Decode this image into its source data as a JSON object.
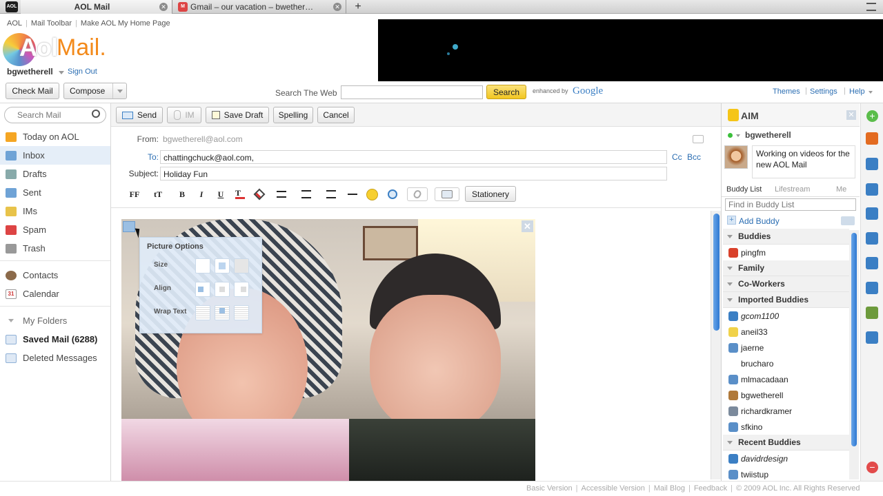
{
  "browser_tabs": [
    {
      "title": "AOL Mail",
      "favicon": "AOL"
    },
    {
      "title": "Gmail – our vacation – bwether…",
      "favicon": "M"
    }
  ],
  "top_links": [
    "AOL",
    "Mail Toolbar",
    "Make AOL My Home Page"
  ],
  "logo": {
    "left": "Aol",
    "right": "Mail."
  },
  "user": {
    "name": "bgwetherell",
    "signout": "Sign Out"
  },
  "toolbar": {
    "check_mail": "Check Mail",
    "compose": "Compose",
    "search_web_label": "Search The Web",
    "search_btn": "Search",
    "enhanced_by": "enhanced by",
    "google": "Google"
  },
  "settings_links": [
    "Themes",
    "Settings",
    "Help"
  ],
  "search_mail": {
    "placeholder": "Search Mail"
  },
  "folders": [
    {
      "label": "Today on AOL",
      "icon": "sun-icon",
      "color": "#f5a623"
    },
    {
      "label": "Inbox",
      "icon": "inbox-icon",
      "color": "#6fa3d6"
    },
    {
      "label": "Drafts",
      "icon": "drafts-icon",
      "color": "#8aa"
    },
    {
      "label": "Sent",
      "icon": "sent-icon",
      "color": "#6fa3d6"
    },
    {
      "label": "IMs",
      "icon": "ims-icon",
      "color": "#e8c34a"
    },
    {
      "label": "Spam",
      "icon": "spam-icon",
      "color": "#d44"
    },
    {
      "label": "Trash",
      "icon": "trash-icon",
      "color": "#999"
    }
  ],
  "tools": [
    {
      "label": "Contacts"
    },
    {
      "label": "Calendar",
      "badge": "31"
    }
  ],
  "my_folders": {
    "title": "My Folders",
    "items": [
      {
        "label": "Saved Mail (6288)",
        "bold": true
      },
      {
        "label": "Deleted Messages"
      }
    ]
  },
  "compose_actions": {
    "send": "Send",
    "im": "IM",
    "save_draft": "Save Draft",
    "spelling": "Spelling",
    "cancel": "Cancel"
  },
  "compose": {
    "from_label": "From:",
    "from_value": "bgwetherell@aol.com",
    "to_label": "To:",
    "to_value": "chattingchuck@aol.com,",
    "cc": "Cc",
    "bcc": "Bcc",
    "subject_label": "Subject:",
    "subject_value": "Holiday Fun"
  },
  "format_bar": {
    "ff": "FF",
    "tt": "tT",
    "bold": "B",
    "italic": "I",
    "underline": "U",
    "stationery": "Stationery"
  },
  "picture_options": {
    "title": "Picture Options",
    "size": "Size",
    "align": "Align",
    "wrap": "Wrap Text"
  },
  "aim": {
    "title": "AIM",
    "user": "bgwetherell",
    "status": "Working on videos for the new AOL Mail",
    "tabs": [
      "Buddy List",
      "Lifestream",
      "Me"
    ],
    "find_placeholder": "Find in Buddy List",
    "add_buddy": "Add Buddy"
  },
  "buddy_list": [
    {
      "type": "group",
      "label": "Buddies"
    },
    {
      "type": "buddy",
      "label": "pingfm",
      "icon": "pingfm-icon",
      "color": "#d9412b"
    },
    {
      "type": "group",
      "label": "Family"
    },
    {
      "type": "group",
      "label": "Co-Workers"
    },
    {
      "type": "group",
      "label": "Imported Buddies"
    },
    {
      "type": "buddy",
      "label": "gcom1100",
      "icon": "idle-zzz-icon",
      "color": "#3b7fc4",
      "italic": true
    },
    {
      "type": "buddy",
      "label": "aneil33",
      "icon": "lightbulb-icon",
      "color": "#f0d24a"
    },
    {
      "type": "buddy",
      "label": "jaerne",
      "icon": "mobile-heart-icon",
      "color": "#5a8fc8"
    },
    {
      "type": "buddy",
      "label": "brucharo",
      "icon": "",
      "color": "transparent"
    },
    {
      "type": "buddy",
      "label": "mlmacadaan",
      "icon": "mobile-heart-icon",
      "color": "#5a8fc8"
    },
    {
      "type": "buddy",
      "label": "bgwetherell",
      "icon": "avatar-icon",
      "color": "#b0793a"
    },
    {
      "type": "buddy",
      "label": "richardkramer",
      "icon": "avatar-icon",
      "color": "#7b8a9c"
    },
    {
      "type": "buddy",
      "label": "sfkino",
      "icon": "mobile-heart-icon",
      "color": "#5a8fc8"
    },
    {
      "type": "group",
      "label": "Recent Buddies"
    },
    {
      "type": "buddy",
      "label": "davidrdesign",
      "icon": "idle-zzz-icon",
      "color": "#3b7fc4",
      "italic": true
    },
    {
      "type": "buddy",
      "label": "twiistup",
      "icon": "mobile-heart-icon",
      "color": "#5a8fc8"
    }
  ],
  "footer": {
    "links": [
      "Basic Version",
      "Accessible Version",
      "Mail Blog",
      "Feedback"
    ],
    "copyright": "© 2009 AOL Inc. All Rights Reserved"
  },
  "colors": {
    "accent": "#2a6db2",
    "search_btn": "#f5d24b",
    "aol_orange": "#f38a1b"
  }
}
